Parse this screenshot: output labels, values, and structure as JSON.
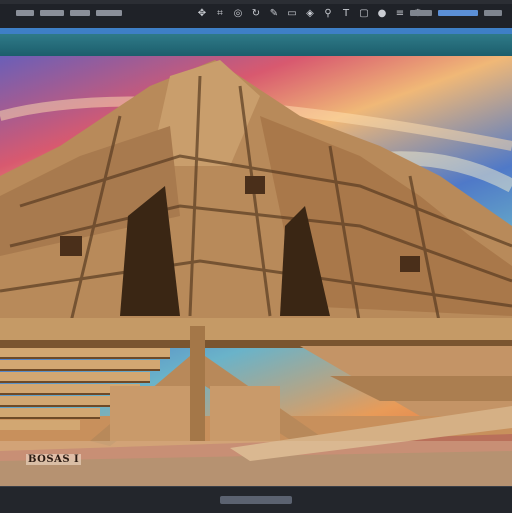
{
  "toolbar": {
    "icons": [
      {
        "name": "move-icon",
        "glyph": "✥"
      },
      {
        "name": "crop-icon",
        "glyph": "⌗"
      },
      {
        "name": "zoom-icon",
        "glyph": "◎"
      },
      {
        "name": "rotate-icon",
        "glyph": "↻"
      },
      {
        "name": "brush-icon",
        "glyph": "✎"
      },
      {
        "name": "eraser-icon",
        "glyph": "▭"
      },
      {
        "name": "fill-icon",
        "glyph": "◈"
      },
      {
        "name": "eyedropper-icon",
        "glyph": "⚲"
      },
      {
        "name": "text-tool-icon",
        "glyph": "T"
      },
      {
        "name": "shape-icon",
        "glyph": "▢"
      },
      {
        "name": "color-picker-icon",
        "glyph": "●"
      },
      {
        "name": "layers-icon",
        "glyph": "≡"
      },
      {
        "name": "settings-icon",
        "glyph": "⚙"
      }
    ]
  },
  "canvas": {
    "caption": "BOSAS I"
  },
  "colors": {
    "toolbar_bg": "#1f2228",
    "accent": "#3e7fc6",
    "subbar": "#2f7a88"
  }
}
